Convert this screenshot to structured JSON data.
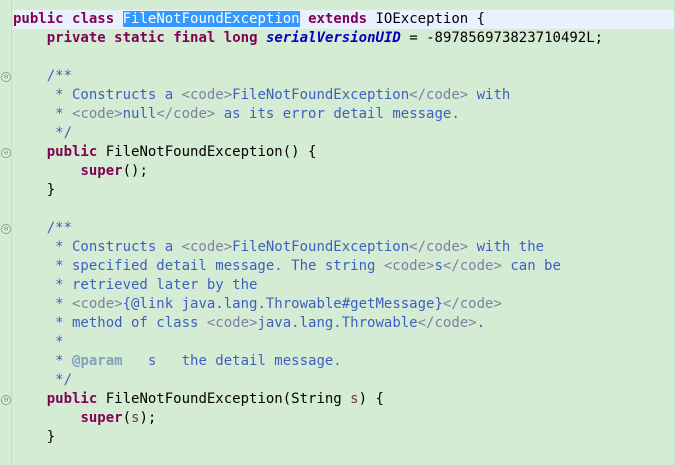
{
  "editor": {
    "lines": [
      {
        "segments": [
          {
            "cls": "kw",
            "text": "public"
          },
          {
            "cls": "",
            "text": " "
          },
          {
            "cls": "kw",
            "text": "class"
          },
          {
            "cls": "",
            "text": " "
          },
          {
            "cls": "sel",
            "text": "FileNotFoundException"
          },
          {
            "cls": "",
            "text": " "
          },
          {
            "cls": "kw",
            "text": "extends"
          },
          {
            "cls": "",
            "text": " IOException {"
          }
        ],
        "current": true
      },
      {
        "segments": [
          {
            "cls": "",
            "text": "    "
          },
          {
            "cls": "kw",
            "text": "private"
          },
          {
            "cls": "",
            "text": " "
          },
          {
            "cls": "kw",
            "text": "static"
          },
          {
            "cls": "",
            "text": " "
          },
          {
            "cls": "kw",
            "text": "final"
          },
          {
            "cls": "",
            "text": " "
          },
          {
            "cls": "kw",
            "text": "long"
          },
          {
            "cls": "",
            "text": " "
          },
          {
            "cls": "fld",
            "text": "serialVersionUID"
          },
          {
            "cls": "",
            "text": " = -897856973823710492L;"
          }
        ]
      },
      {
        "segments": [
          {
            "cls": "",
            "text": ""
          }
        ]
      },
      {
        "segments": [
          {
            "cls": "",
            "text": "    "
          },
          {
            "cls": "cm",
            "text": "/**"
          }
        ],
        "fold": "open"
      },
      {
        "segments": [
          {
            "cls": "cm",
            "text": "     * Constructs a "
          },
          {
            "cls": "tag",
            "text": "<code>"
          },
          {
            "cls": "cm",
            "text": "FileNotFoundException"
          },
          {
            "cls": "tag",
            "text": "</code>"
          },
          {
            "cls": "cm",
            "text": " with"
          }
        ]
      },
      {
        "segments": [
          {
            "cls": "cm",
            "text": "     * "
          },
          {
            "cls": "tag",
            "text": "<code>"
          },
          {
            "cls": "cm",
            "text": "null"
          },
          {
            "cls": "tag",
            "text": "</code>"
          },
          {
            "cls": "cm",
            "text": " as its error detail message."
          }
        ]
      },
      {
        "segments": [
          {
            "cls": "cm",
            "text": "     */"
          }
        ]
      },
      {
        "segments": [
          {
            "cls": "",
            "text": "    "
          },
          {
            "cls": "kw",
            "text": "public"
          },
          {
            "cls": "",
            "text": " FileNotFoundException() {"
          }
        ],
        "fold": "open"
      },
      {
        "segments": [
          {
            "cls": "",
            "text": "        "
          },
          {
            "cls": "kw",
            "text": "super"
          },
          {
            "cls": "",
            "text": "();"
          }
        ]
      },
      {
        "segments": [
          {
            "cls": "",
            "text": "    }"
          }
        ]
      },
      {
        "segments": [
          {
            "cls": "",
            "text": ""
          }
        ]
      },
      {
        "segments": [
          {
            "cls": "",
            "text": "    "
          },
          {
            "cls": "cm",
            "text": "/**"
          }
        ],
        "fold": "open"
      },
      {
        "segments": [
          {
            "cls": "cm",
            "text": "     * Constructs a "
          },
          {
            "cls": "tag",
            "text": "<code>"
          },
          {
            "cls": "cm",
            "text": "FileNotFoundException"
          },
          {
            "cls": "tag",
            "text": "</code>"
          },
          {
            "cls": "cm",
            "text": " with the"
          }
        ]
      },
      {
        "segments": [
          {
            "cls": "cm",
            "text": "     * specified detail message. The string "
          },
          {
            "cls": "tag",
            "text": "<code>"
          },
          {
            "cls": "cm",
            "text": "s"
          },
          {
            "cls": "tag",
            "text": "</code>"
          },
          {
            "cls": "cm",
            "text": " can be"
          }
        ]
      },
      {
        "segments": [
          {
            "cls": "cm",
            "text": "     * retrieved later by the"
          }
        ]
      },
      {
        "segments": [
          {
            "cls": "cm",
            "text": "     * "
          },
          {
            "cls": "tag",
            "text": "<code>"
          },
          {
            "cls": "cm",
            "text": "{@link java.lang.Throwable#getMessage}"
          },
          {
            "cls": "tag",
            "text": "</code>"
          }
        ]
      },
      {
        "segments": [
          {
            "cls": "cm",
            "text": "     * method of class "
          },
          {
            "cls": "tag",
            "text": "<code>"
          },
          {
            "cls": "cm",
            "text": "java.lang.Throwable"
          },
          {
            "cls": "tag",
            "text": "</code>"
          },
          {
            "cls": "cm",
            "text": "."
          }
        ]
      },
      {
        "segments": [
          {
            "cls": "cm",
            "text": "     *"
          }
        ]
      },
      {
        "segments": [
          {
            "cls": "cm",
            "text": "     * "
          },
          {
            "cls": "ann",
            "text": "@param"
          },
          {
            "cls": "cm",
            "text": "   s   the detail message."
          }
        ]
      },
      {
        "segments": [
          {
            "cls": "cm",
            "text": "     */"
          }
        ]
      },
      {
        "segments": [
          {
            "cls": "",
            "text": "    "
          },
          {
            "cls": "kw",
            "text": "public"
          },
          {
            "cls": "",
            "text": " FileNotFoundException(String "
          },
          {
            "cls": "var",
            "text": "s"
          },
          {
            "cls": "",
            "text": ") {"
          }
        ],
        "fold": "open"
      },
      {
        "segments": [
          {
            "cls": "",
            "text": "        "
          },
          {
            "cls": "kw",
            "text": "super"
          },
          {
            "cls": "",
            "text": "("
          },
          {
            "cls": "var",
            "text": "s"
          },
          {
            "cls": "",
            "text": ");"
          }
        ]
      },
      {
        "segments": [
          {
            "cls": "",
            "text": "    }"
          }
        ]
      }
    ],
    "fold_glyph": "⊖"
  },
  "colors": {
    "background": "#d4ecd4",
    "keyword": "#7f0055",
    "field": "#0000c0",
    "javadoc": "#3f5fbf",
    "javadoc_tag": "#7f7f9f",
    "annotation": "#7f9fbf",
    "selection": "#3399ff",
    "current_line": "#e8f2fe"
  }
}
